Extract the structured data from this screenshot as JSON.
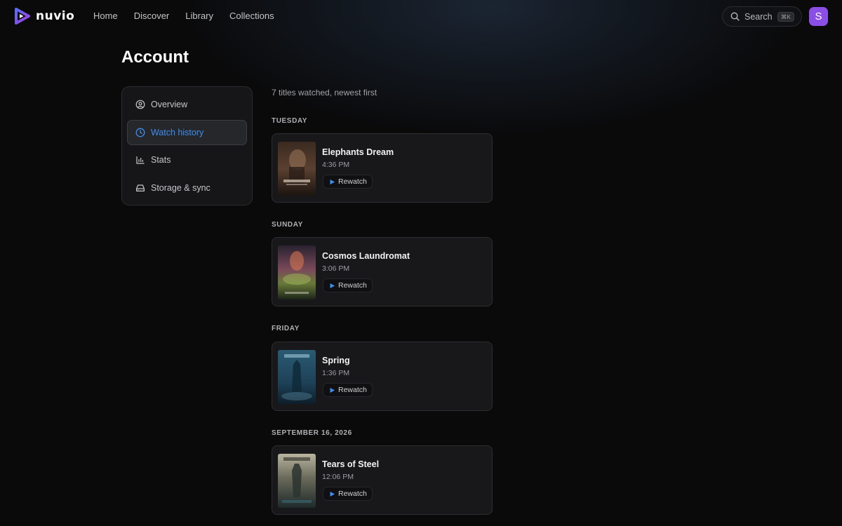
{
  "brand": {
    "name": "nuvio",
    "accent": "#7c3aed"
  },
  "nav": [
    {
      "label": "Home"
    },
    {
      "label": "Discover"
    },
    {
      "label": "Library"
    },
    {
      "label": "Collections"
    }
  ],
  "search": {
    "label": "Search",
    "shortcut": "⌘K",
    "icon": "search-icon"
  },
  "user": {
    "initial": "S",
    "color": "#8b4fe6"
  },
  "page": {
    "title": "Account"
  },
  "sidebar": {
    "items": [
      {
        "label": "Overview",
        "icon": "user-circle-icon",
        "active": false
      },
      {
        "label": "Watch history",
        "icon": "clock-icon",
        "active": true
      },
      {
        "label": "Stats",
        "icon": "bar-chart-icon",
        "active": false
      },
      {
        "label": "Storage & sync",
        "icon": "hard-drive-icon",
        "active": false
      }
    ],
    "active_color": "#3d8ef0"
  },
  "history": {
    "summary": "7 titles watched, newest first",
    "rewatch_label": "Rewatch",
    "groups": [
      {
        "label": "TUESDAY",
        "entries": [
          {
            "title": "Elephants Dream",
            "time": "4:36 PM"
          }
        ]
      },
      {
        "label": "SUNDAY",
        "entries": [
          {
            "title": "Cosmos Laundromat",
            "time": "3:06 PM"
          }
        ]
      },
      {
        "label": "FRIDAY",
        "entries": [
          {
            "title": "Spring",
            "time": "1:36 PM"
          }
        ]
      },
      {
        "label": "SEPTEMBER 16, 2026",
        "entries": [
          {
            "title": "Tears of Steel",
            "time": "12:06 PM"
          }
        ]
      }
    ]
  }
}
